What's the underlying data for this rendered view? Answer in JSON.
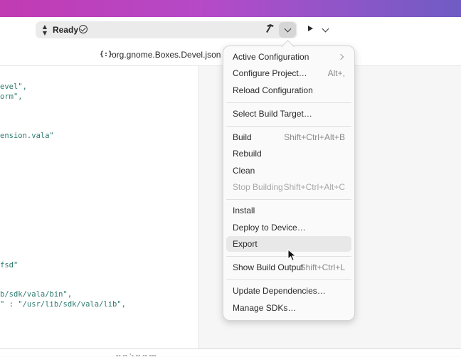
{
  "omnibar": {
    "status": "Ready"
  },
  "tab": {
    "filename": "org.gnome.Boxes.Devel.json",
    "icon_glyph": "{:}"
  },
  "editor": {
    "lines": [
      "evel\",",
      "orm\",",
      "ension.vala\"",
      "fsd\"",
      "b/sdk/vala/bin\",",
      "\" : \"/usr/lib/sdk/vala/lib\","
    ]
  },
  "bottom": {
    "text": "--   -- ;-  --   --  ---"
  },
  "menu": {
    "items": [
      {
        "label": "Active Configuration",
        "accel": "",
        "submenu": true
      },
      {
        "label": "Configure Project…",
        "accel": "Alt+,"
      },
      {
        "label": "Reload Configuration",
        "accel": ""
      },
      {
        "label": "Select Build Target…",
        "accel": ""
      },
      {
        "label": "Build",
        "accel": "Shift+Ctrl+Alt+B"
      },
      {
        "label": "Rebuild",
        "accel": ""
      },
      {
        "label": "Clean",
        "accel": ""
      },
      {
        "label": "Stop Building",
        "accel": "Shift+Ctrl+Alt+C",
        "disabled": true
      },
      {
        "label": "Install",
        "accel": ""
      },
      {
        "label": "Deploy to Device…",
        "accel": ""
      },
      {
        "label": "Export",
        "accel": "",
        "hovered": true
      },
      {
        "label": "Show Build Output",
        "accel": "Shift+Ctrl+L"
      },
      {
        "label": "Update Dependencies…",
        "accel": ""
      },
      {
        "label": "Manage SDKs…",
        "accel": ""
      }
    ]
  },
  "colors": {
    "accent_gradient_start": "#c13bb3",
    "accent_gradient_end": "#6f5cc4",
    "string_literal": "#2d7a6e"
  },
  "icons": [
    "up-down-arrows-icon",
    "checkmark-circle-icon",
    "hammer-icon",
    "chevron-down-icon",
    "play-icon",
    "json-file-icon",
    "submenu-arrow-icon",
    "mouse-pointer-icon"
  ]
}
